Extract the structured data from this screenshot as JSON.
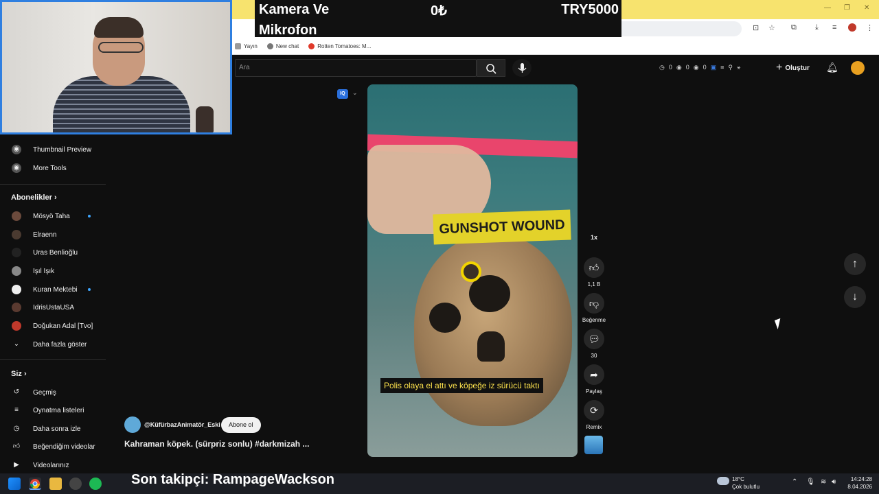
{
  "banner": {
    "item": "Kamera Ve",
    "item2": "Mikrofon",
    "current": "0₺",
    "goal": "TRY5000"
  },
  "bookmarks": [
    {
      "label": "Yayın",
      "color": "#888888"
    },
    {
      "label": "New chat",
      "color": "#777777"
    },
    {
      "label": "Rotten Tomatoes: M...",
      "color": "#e03a2b"
    }
  ],
  "sidebar": {
    "tools": [
      "Thumbnail Preview",
      "More Tools"
    ],
    "subs_header": "Abonelikler",
    "subs": [
      {
        "label": "Mösyö Taha",
        "dot": true
      },
      {
        "label": "Elraenn",
        "dot": false
      },
      {
        "label": "Uras Benlioğlu",
        "dot": false
      },
      {
        "label": "Işıl Işık",
        "dot": false
      },
      {
        "label": "Kuran Mektebi",
        "dot": true
      },
      {
        "label": "IdrisUstaUSA",
        "dot": false
      },
      {
        "label": "Doğukan Adal [Tvo]",
        "dot": false
      }
    ],
    "show_more": "Daha fazla göster",
    "you_header": "Siz",
    "you": [
      "Geçmiş",
      "Oynatma listeleri",
      "Daha sonra izle",
      "Beğendiğim videolar",
      "Videolarınız"
    ]
  },
  "search": {
    "placeholder": "Ara"
  },
  "toolbar": {
    "counters": [
      "0",
      "0",
      "0"
    ],
    "create_label": "Oluştur"
  },
  "video": {
    "tape_text": "GUNSHOT WOUND",
    "subtitle": "Polis olaya el attı ve köpeğe iz sürücü taktı"
  },
  "rail": {
    "speed": "1x",
    "likes": "1,1 B",
    "dislike": "Beğenme",
    "comments": "30",
    "share": "Paylaş",
    "remix": "Remix"
  },
  "channel": {
    "name": "@KüfürbazAnimatör_Eski",
    "subscribe": "Abone ol",
    "title": "Kahraman köpek. (sürpriz sonlu) #darkmizah ..."
  },
  "taskbar": {
    "follower_text": "Son takipçi: RampageWackson",
    "temp": "18°C",
    "weather": "Çok bulutlu",
    "time": "14:24:28",
    "date": "8.04.2026"
  }
}
